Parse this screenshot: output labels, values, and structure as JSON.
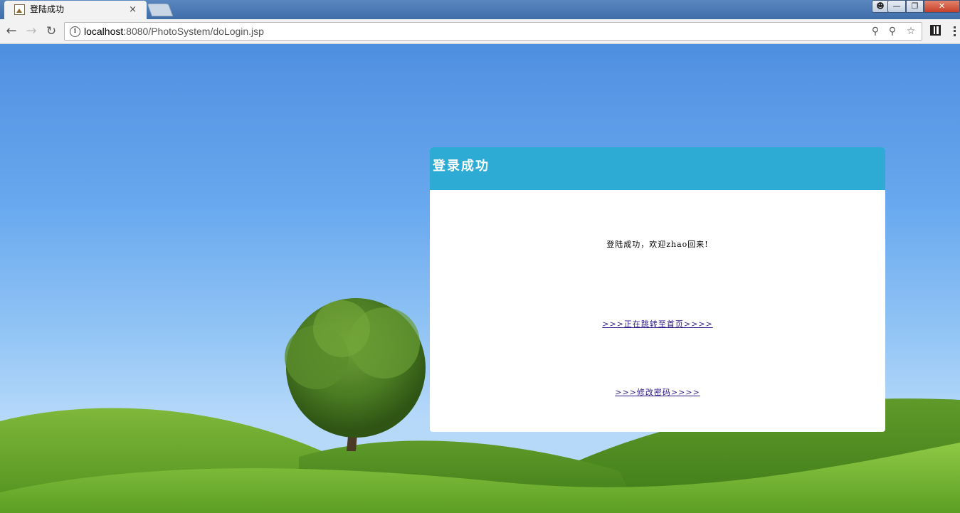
{
  "browser": {
    "tab_title": "登陆成功",
    "tab_close": "×",
    "url_host": "localhost",
    "url_rest": ":8080/PhotoSystem/doLogin.jsp",
    "icons": {
      "back": "back-arrow-icon",
      "forward": "forward-arrow-icon",
      "reload": "reload-icon",
      "info": "info-icon",
      "zoom": "zoom-icon",
      "key": "key-icon",
      "star": "star-icon",
      "qr": "qr-code-icon",
      "menu": "menu-dots-icon"
    }
  },
  "page": {
    "header_title": "登录成功",
    "welcome": "登陆成功，欢迎zhao回来!",
    "link_home": ">>>正在跳转至首页>>>>",
    "link_password": ">>>修改密码>>>>",
    "colors": {
      "header": "#2eabd4",
      "panel": "#ffffff",
      "link": "#2a1a8a"
    }
  }
}
